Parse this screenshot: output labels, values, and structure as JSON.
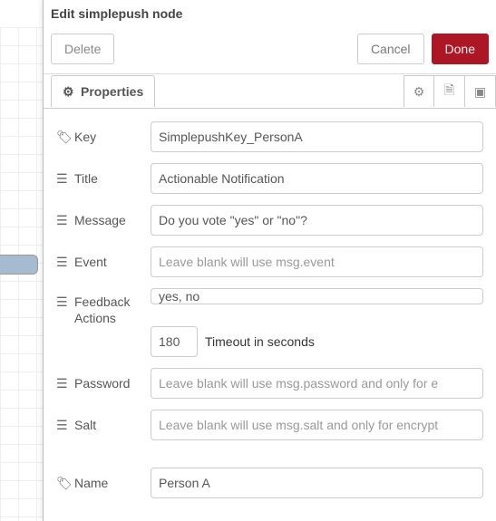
{
  "header": {
    "title": "Edit simplepush node"
  },
  "toolbar": {
    "delete": "Delete",
    "cancel": "Cancel",
    "done": "Done"
  },
  "tabs": {
    "properties": "Properties"
  },
  "icons": {
    "settings_tab": "settings",
    "description_tab": "description",
    "appearance_tab": "appearance"
  },
  "fields": {
    "key": {
      "label": "Key",
      "value": "SimplepushKey_PersonA"
    },
    "title": {
      "label": "Title",
      "value": "Actionable Notification"
    },
    "message": {
      "label": "Message",
      "value": "Do you vote \"yes\" or \"no\"?"
    },
    "event": {
      "label": "Event",
      "value": "",
      "placeholder": "Leave blank will use msg.event"
    },
    "actions": {
      "label": "Feedback Actions",
      "value": "yes, no"
    },
    "timeout": {
      "value": "180",
      "label": "Timeout in seconds"
    },
    "password": {
      "label": "Password",
      "value": "",
      "placeholder": "Leave blank will use msg.password and only for e"
    },
    "salt": {
      "label": "Salt",
      "value": "",
      "placeholder": "Leave blank will use msg.salt and only for encrypt"
    },
    "name": {
      "label": "Name",
      "value": "Person A"
    }
  }
}
